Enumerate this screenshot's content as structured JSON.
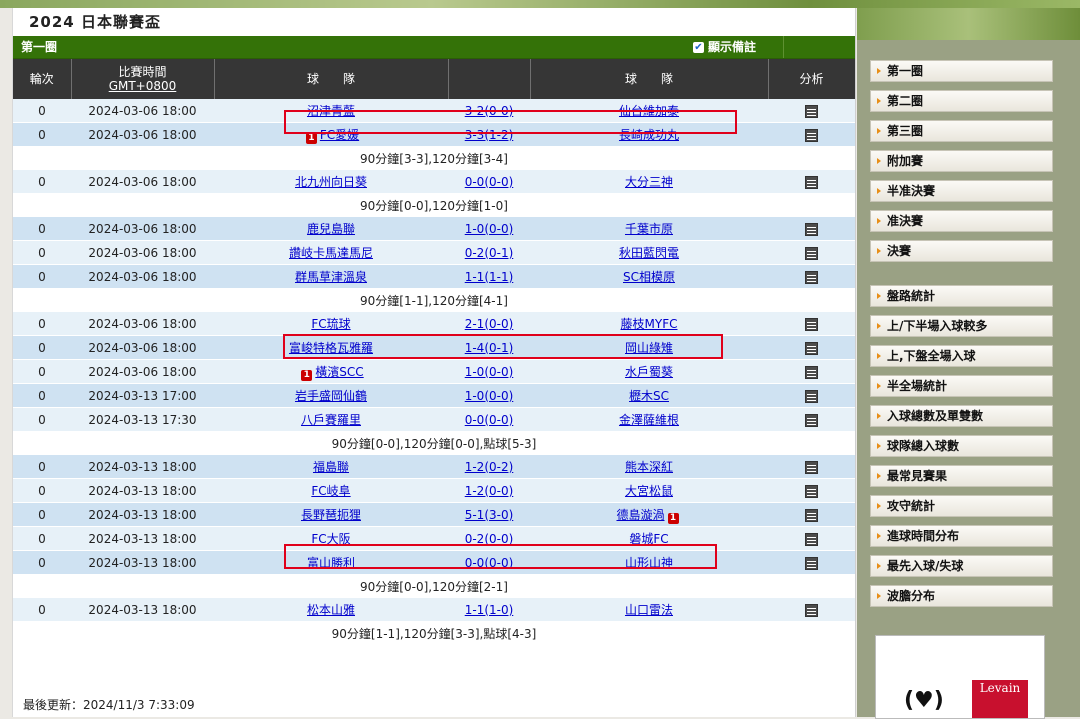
{
  "page": {
    "title": "2024 日本聯賽盃",
    "round_name": "第一圈",
    "show_notes_label": "顯示備註",
    "last_updated": "最後更新：2024/11/3 7:33:09"
  },
  "table": {
    "headers": {
      "round": "輪次",
      "time_line1": "比賽時間",
      "time_line2": "GMT+0800",
      "team_left": "球　　隊",
      "team_right": "球　　隊",
      "analysis": "分析"
    },
    "rows": [
      {
        "type": "match",
        "round": "0",
        "time": "2024-03-06 18:00",
        "home": "沼津青藍",
        "score": "3-2(0-0)",
        "away": "仙台維加泰",
        "home_red": false,
        "away_red": false
      },
      {
        "type": "match",
        "round": "0",
        "time": "2024-03-06 18:00",
        "home": "FC愛媛",
        "score": "3-3(1-2)",
        "away": "長崎成功丸",
        "home_red": true,
        "away_red": false
      },
      {
        "type": "note",
        "text": "90分鐘[3-3],120分鐘[3-4]"
      },
      {
        "type": "match",
        "round": "0",
        "time": "2024-03-06 18:00",
        "home": "北九州向日葵",
        "score": "0-0(0-0)",
        "away": "大分三神",
        "home_red": false,
        "away_red": false
      },
      {
        "type": "note",
        "text": "90分鐘[0-0],120分鐘[1-0]"
      },
      {
        "type": "match",
        "round": "0",
        "time": "2024-03-06 18:00",
        "home": "鹿兒島聯",
        "score": "1-0(0-0)",
        "away": "千葉市原",
        "home_red": false,
        "away_red": false
      },
      {
        "type": "match",
        "round": "0",
        "time": "2024-03-06 18:00",
        "home": "讚岐卡馬達馬尼",
        "score": "0-2(0-1)",
        "away": "秋田藍閃電",
        "home_red": false,
        "away_red": false
      },
      {
        "type": "match",
        "round": "0",
        "time": "2024-03-06 18:00",
        "home": "群馬草津溫泉",
        "score": "1-1(1-1)",
        "away": "SC相模原",
        "home_red": false,
        "away_red": false
      },
      {
        "type": "note",
        "text": "90分鐘[1-1],120分鐘[4-1]"
      },
      {
        "type": "match",
        "round": "0",
        "time": "2024-03-06 18:00",
        "home": "FC琉球",
        "score": "2-1(0-0)",
        "away": "藤枝MYFC",
        "home_red": false,
        "away_red": false
      },
      {
        "type": "match",
        "round": "0",
        "time": "2024-03-06 18:00",
        "home": "富峻特格瓦雅羅",
        "score": "1-4(0-1)",
        "away": "岡山綠雉",
        "home_red": false,
        "away_red": false
      },
      {
        "type": "match",
        "round": "0",
        "time": "2024-03-06 18:00",
        "home": "橫濱SCC",
        "score": "1-0(0-0)",
        "away": "水戶蜀葵",
        "home_red": true,
        "away_red": false
      },
      {
        "type": "match",
        "round": "0",
        "time": "2024-03-13 17:00",
        "home": "岩手盛岡仙鶴",
        "score": "1-0(0-0)",
        "away": "櫪木SC",
        "home_red": false,
        "away_red": false
      },
      {
        "type": "match",
        "round": "0",
        "time": "2024-03-13 17:30",
        "home": "八戶賽羅里",
        "score": "0-0(0-0)",
        "away": "金澤薩維根",
        "home_red": false,
        "away_red": false
      },
      {
        "type": "note",
        "text": "90分鐘[0-0],120分鐘[0-0],點球[5-3]"
      },
      {
        "type": "match",
        "round": "0",
        "time": "2024-03-13 18:00",
        "home": "福島聯",
        "score": "1-2(0-2)",
        "away": "熊本深紅",
        "home_red": false,
        "away_red": false
      },
      {
        "type": "match",
        "round": "0",
        "time": "2024-03-13 18:00",
        "home": "FC岐阜",
        "score": "1-2(0-0)",
        "away": "大宮松鼠",
        "home_red": false,
        "away_red": false
      },
      {
        "type": "match",
        "round": "0",
        "time": "2024-03-13 18:00",
        "home": "長野琶扼狸",
        "score": "5-1(3-0)",
        "away": "德島漩渦",
        "home_red": false,
        "away_red": true
      },
      {
        "type": "match",
        "round": "0",
        "time": "2024-03-13 18:00",
        "home": "FC大阪",
        "score": "0-2(0-0)",
        "away": "磐城FC",
        "home_red": false,
        "away_red": false
      },
      {
        "type": "match",
        "round": "0",
        "time": "2024-03-13 18:00",
        "home": "富山勝利",
        "score": "0-0(0-0)",
        "away": "山形山神",
        "home_red": false,
        "away_red": false
      },
      {
        "type": "note",
        "text": "90分鐘[0-0],120分鐘[2-1]"
      },
      {
        "type": "match",
        "round": "0",
        "time": "2024-03-13 18:00",
        "home": "松本山雅",
        "score": "1-1(1-0)",
        "away": "山口雷法",
        "home_red": false,
        "away_red": false
      },
      {
        "type": "note",
        "text": "90分鐘[1-1],120分鐘[3-3],點球[4-3]"
      }
    ]
  },
  "sidebar": {
    "rounds": [
      "第一圈",
      "第二圈",
      "第三圈",
      "附加賽",
      "半准決賽",
      "准決賽",
      "決賽"
    ],
    "stats": [
      "盤路統計",
      "上/下半場入球較多",
      "上,下盤全場入球",
      "半全場統計",
      "入球總數及單雙數",
      "球隊總入球數",
      "最常見賽果",
      "攻守統計",
      "進球時間分布",
      "最先入球/失球",
      "波膽分布"
    ],
    "promo_text": "Levain"
  },
  "colors": {
    "header_green": "#347208",
    "highlight_red": "#e0001b",
    "row_light": "#e7f1f8",
    "row_dark": "#cfe2f2"
  },
  "icons": {
    "analysis": "analysis-icon",
    "red_card": "red-card-icon",
    "checkbox": "checkbox-icon"
  }
}
